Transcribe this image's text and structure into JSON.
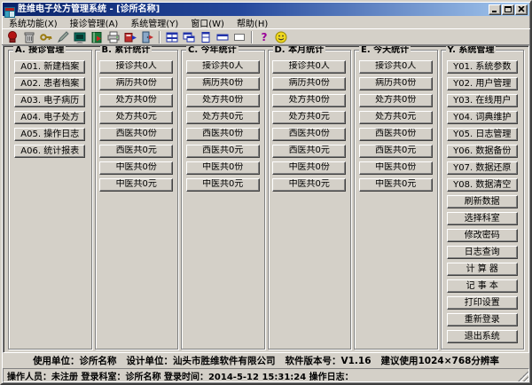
{
  "window": {
    "title": "胜维电子处方管理系统 - [诊所名称]",
    "controls": {
      "minimize": "minimize",
      "maximize": "maximize",
      "close": "close"
    }
  },
  "menu": {
    "items": [
      "系统功能(X)",
      "接诊管理(A)",
      "系统管理(Y)",
      "窗口(W)",
      "帮助(H)"
    ]
  },
  "toolbar": {
    "icons": [
      "seal-icon",
      "trash-icon",
      "key-icon",
      "edit-icon",
      "monitor-icon",
      "data-book-icon",
      "printer-icon",
      "export-icon",
      "exit-door-icon",
      "tile-windows-icon",
      "cascade-windows-icon",
      "split-vertical-icon",
      "split-horizontal-icon",
      "plain-window-icon",
      "help-icon",
      "smiley-icon"
    ]
  },
  "panels": {
    "a": {
      "title": "A. 接诊管理",
      "buttons": [
        "A01. 新建档案",
        "A02. 患者档案",
        "A03. 电子病历",
        "A04. 电子处方",
        "A05. 操作日志",
        "A06. 统计报表"
      ]
    },
    "b": {
      "title": "B. 累计统计",
      "stats": [
        "接诊共0人",
        "病历共0份",
        "处方共0份",
        "处方共0元",
        "西医共0份",
        "西医共0元",
        "中医共0份",
        "中医共0元"
      ]
    },
    "c": {
      "title": "C. 今年统计",
      "stats": [
        "接诊共0人",
        "病历共0份",
        "处方共0份",
        "处方共0元",
        "西医共0份",
        "西医共0元",
        "中医共0份",
        "中医共0元"
      ]
    },
    "d": {
      "title": "D. 本月统计",
      "stats": [
        "接诊共0人",
        "病历共0份",
        "处方共0份",
        "处方共0元",
        "西医共0份",
        "西医共0元",
        "中医共0份",
        "中医共0元"
      ]
    },
    "e": {
      "title": "E. 今天统计",
      "stats": [
        "接诊共0人",
        "病历共0份",
        "处方共0份",
        "处方共0元",
        "西医共0份",
        "西医共0元",
        "中医共0份",
        "中医共0元"
      ]
    },
    "y": {
      "title": "Y. 系统管理",
      "buttons": [
        "Y01. 系统参数",
        "Y02. 用户管理",
        "Y03. 在线用户",
        "Y04. 词典维护",
        "Y05. 日志管理",
        "Y06. 数据备份",
        "Y07. 数据还原",
        "Y08. 数据清空"
      ],
      "utilities": [
        "刷新数据",
        "选择科室",
        "修改密码",
        "日志查询",
        "计 算 器",
        "记 事 本",
        "打印设置",
        "重新登录",
        "退出系统"
      ]
    }
  },
  "footer": {
    "text": "使用单位：诊所名称   设计单位：汕头市胜维软件有限公司   软件版本号：V1.16   建议使用1024×768分辨率"
  },
  "statusbar": {
    "text": "操作人员：未注册 登录科室：诊所名称 登录时间：2014-5-12 15:31:24 操作日志："
  },
  "colors": {
    "titlebar_start": "#0a246a",
    "titlebar_end": "#a6caf0",
    "chrome": "#d4d0c8"
  }
}
